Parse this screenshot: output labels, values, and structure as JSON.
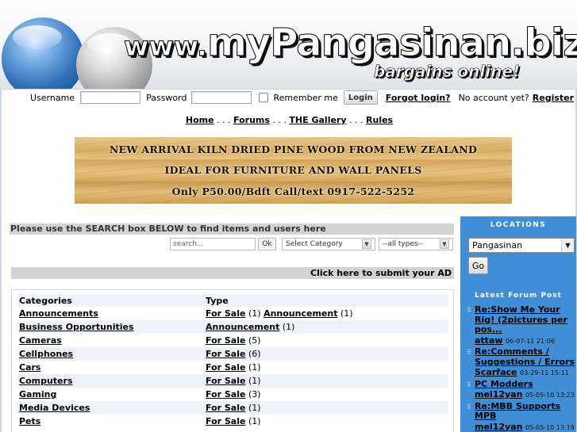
{
  "header": {
    "logo_www": "www.",
    "logo_main": "myPangasinan.biz",
    "tagline": "bargains online!"
  },
  "login": {
    "username_label": "Username",
    "password_label": "Password",
    "remember_label": "Remember me",
    "login_button": "Login",
    "forgot_link": "Forgot login?",
    "no_account_text": "No account yet?",
    "register_link": "Register"
  },
  "nav": {
    "items": [
      "Home",
      "Forums",
      "THE Gallery",
      "Rules"
    ],
    "separator": ". . ."
  },
  "banner": {
    "lines": [
      "NEW ARRIVAL KILN DRIED PINE WOOD FROM NEW ZEALAND",
      "IDEAL FOR FURNITURE AND WALL PANELS",
      "Only P50.00/Bdft Call/text 0917-522-5252"
    ]
  },
  "search": {
    "heading": "Please use the SEARCH box BELOW to find items and users here",
    "input_placeholder": "search...",
    "ok_label": "Ok",
    "category_select": "Select Category",
    "types_select": "--all types--"
  },
  "submit_ad_link": "Click here to submit your AD",
  "categories": {
    "header_category": "Categories",
    "header_type": "Type",
    "rows": [
      {
        "name": "Announcements",
        "types": [
          {
            "label": "For Sale",
            "count": "(1)"
          },
          {
            "label": "Announcement",
            "count": "(1)"
          }
        ]
      },
      {
        "name": "Business Opportunities",
        "types": [
          {
            "label": "Announcement",
            "count": "(1)"
          }
        ]
      },
      {
        "name": "Cameras",
        "types": [
          {
            "label": "For Sale",
            "count": "(5)"
          }
        ]
      },
      {
        "name": "Cellphones",
        "types": [
          {
            "label": "For Sale",
            "count": "(6)"
          }
        ]
      },
      {
        "name": "Cars",
        "types": [
          {
            "label": "For Sale",
            "count": "(1)"
          }
        ]
      },
      {
        "name": "Computers",
        "types": [
          {
            "label": "For Sale",
            "count": "(1)"
          }
        ]
      },
      {
        "name": "Gaming",
        "types": [
          {
            "label": "For Sale",
            "count": "(3)"
          }
        ]
      },
      {
        "name": "Media Devices",
        "types": [
          {
            "label": "For Sale",
            "count": "(1)"
          }
        ]
      },
      {
        "name": "Pets",
        "types": [
          {
            "label": "For Sale",
            "count": "(1)"
          }
        ]
      }
    ]
  },
  "sidebar": {
    "locations_title": "LOCATIONS",
    "location_selected": "Pangasinan",
    "go_button": "Go",
    "forum_title": "Latest Forum Post",
    "posts": [
      {
        "title": "Re:Show Me Your Rig! (2pictures per pos...",
        "author": "attaw",
        "date": "06-07-11 21:06"
      },
      {
        "title": "Re:Comments / Suggestions / Errors",
        "author": "Scarface",
        "date": "03-29-11 15:11"
      },
      {
        "title": "PC Modders",
        "author": "mel12yan",
        "date": "05-05-10 13:23"
      },
      {
        "title": "Re:MBB Supports MPB",
        "author": "mel12yan",
        "date": "05-05-10 13:19"
      }
    ]
  },
  "colors": {
    "sidebar_bg": "#3f8ed6",
    "bar_bg": "#d3d3d3",
    "row_alt": "#eef3fa"
  }
}
